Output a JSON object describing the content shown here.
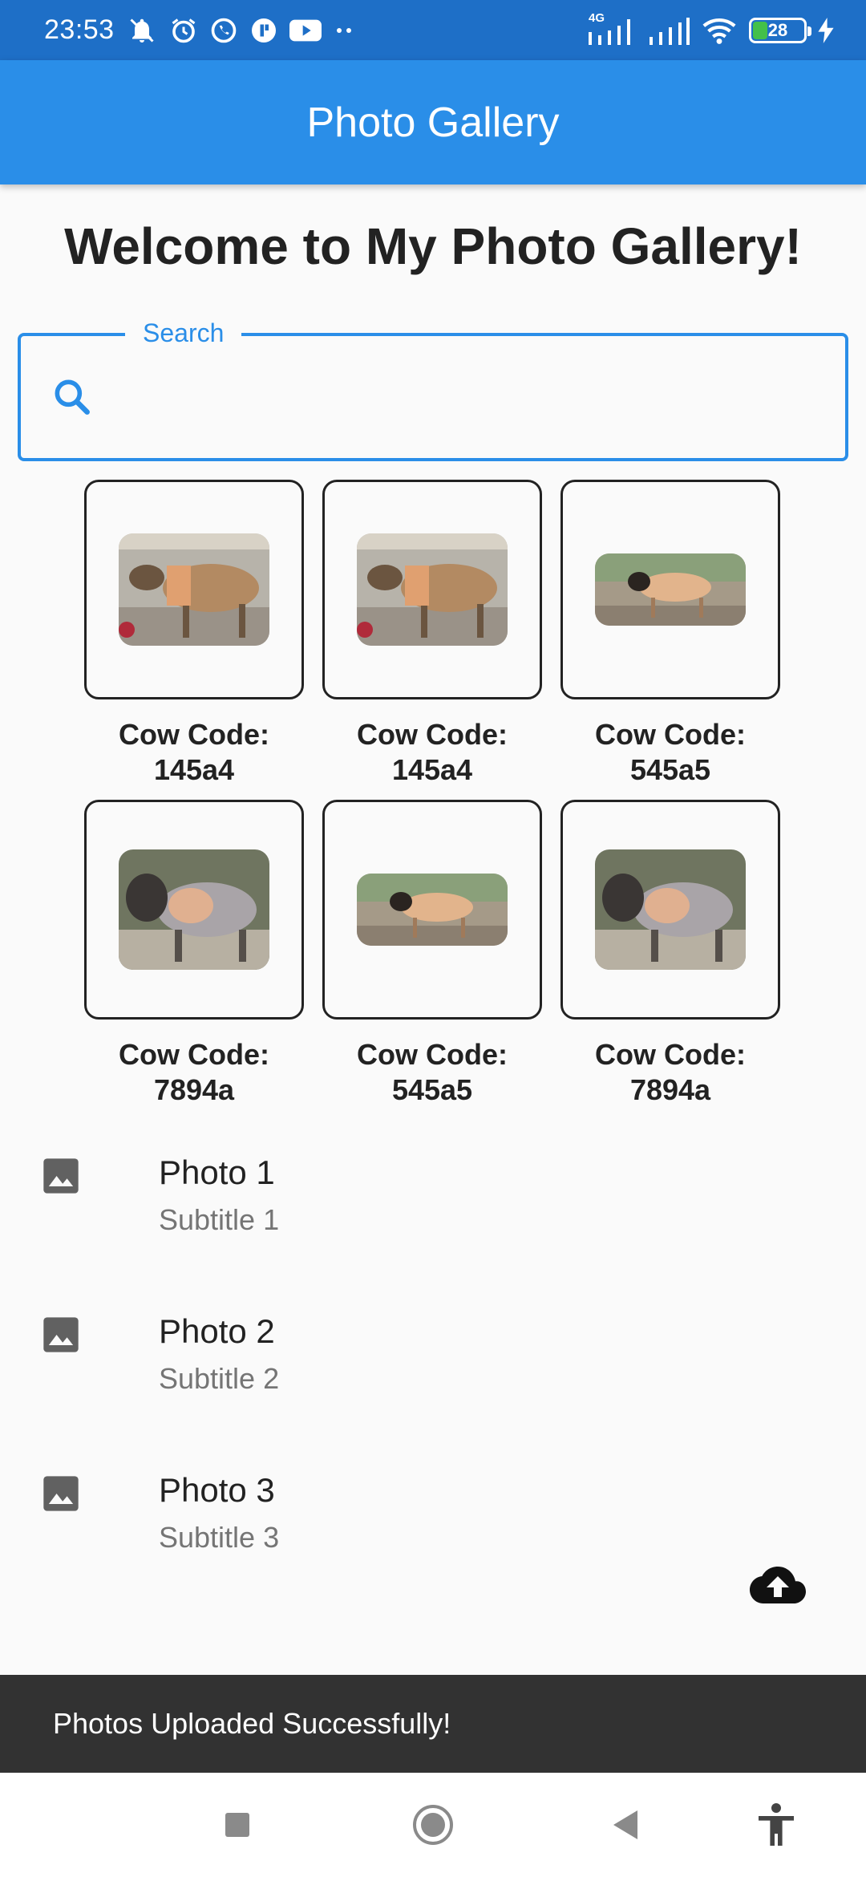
{
  "status_bar": {
    "time": "23:53",
    "network": "4G",
    "battery": "28",
    "battery_level": 0.28,
    "icons": [
      "mute-icon",
      "alarm-icon",
      "whatsapp-icon",
      "app-icon",
      "youtube-icon",
      "more-dots-icon",
      "signal-icon",
      "signal-icon",
      "wifi-icon",
      "battery-icon",
      "charging-icon"
    ]
  },
  "app_bar": {
    "title": "Photo Gallery"
  },
  "welcome": "Welcome to My Photo Gallery!",
  "search": {
    "label": "Search",
    "value": "",
    "icon": "search-icon"
  },
  "grid": {
    "items": [
      {
        "label": "Cow Code: 145a4"
      },
      {
        "label": "Cow Code: 145a4"
      },
      {
        "label": "Cow Code: 545a5"
      },
      {
        "label": "Cow Code: 7894a"
      },
      {
        "label": "Cow Code: 545a5"
      },
      {
        "label": "Cow Code: 7894a"
      }
    ]
  },
  "list": {
    "items": [
      {
        "title": "Photo 1",
        "subtitle": "Subtitle 1",
        "icon": "image-icon"
      },
      {
        "title": "Photo 2",
        "subtitle": "Subtitle 2",
        "icon": "image-icon"
      },
      {
        "title": "Photo 3",
        "subtitle": "Subtitle 3",
        "icon": "image-icon"
      }
    ]
  },
  "upload": {
    "icon": "cloud-upload-icon"
  },
  "snackbar": {
    "message": "Photos Uploaded Successfully!"
  },
  "nav": {
    "icons": [
      "recents-icon",
      "home-icon",
      "back-icon",
      "accessibility-icon"
    ]
  },
  "colors": {
    "status_bar": "#1e6fc7",
    "app_bar": "#2a8ee8",
    "accent": "#2a8ee8",
    "snackbar": "#323232",
    "background": "#fafafa"
  }
}
